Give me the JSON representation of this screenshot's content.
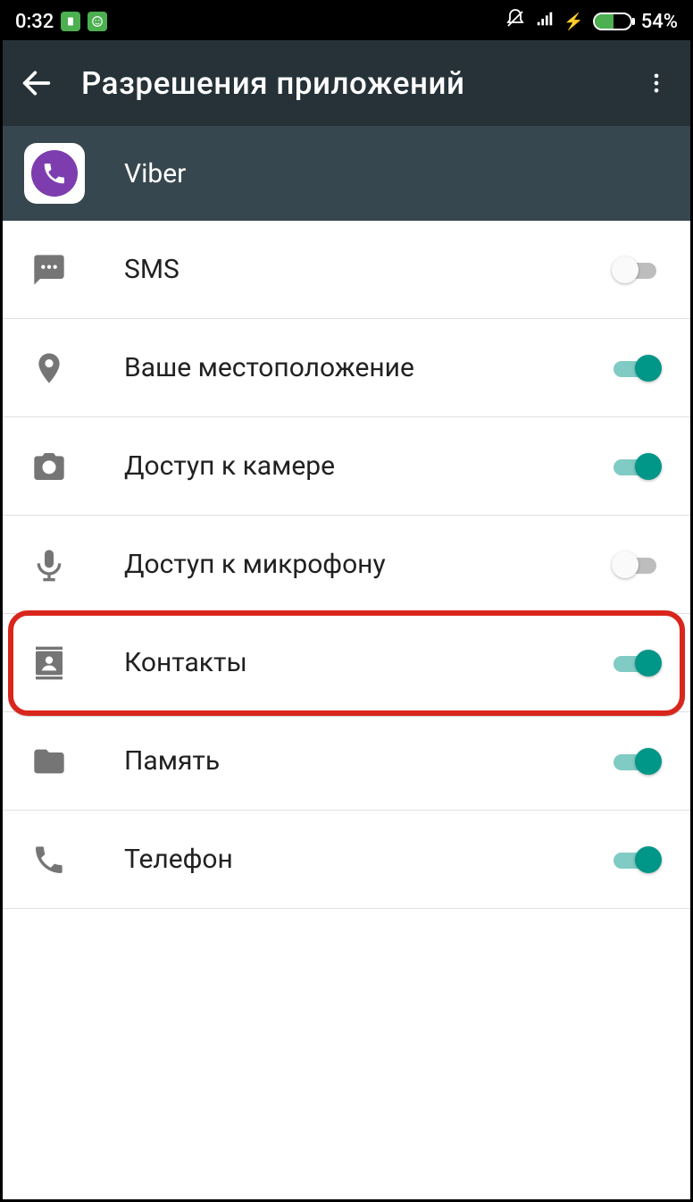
{
  "status": {
    "time": "0:32",
    "battery_pct": "54%",
    "battery_fill_color": "#4caf50",
    "battery_fill_width": "54%"
  },
  "toolbar": {
    "title": "Разрешения приложений"
  },
  "app": {
    "name": "Viber"
  },
  "permissions": [
    {
      "key": "sms",
      "label": "SMS",
      "enabled": false
    },
    {
      "key": "location",
      "label": "Ваше местоположение",
      "enabled": true
    },
    {
      "key": "camera",
      "label": "Доступ к камере",
      "enabled": true
    },
    {
      "key": "microphone",
      "label": "Доступ к микрофону",
      "enabled": false
    },
    {
      "key": "contacts",
      "label": "Контакты",
      "enabled": true,
      "highlighted": true
    },
    {
      "key": "storage",
      "label": "Память",
      "enabled": true
    },
    {
      "key": "phone",
      "label": "Телефон",
      "enabled": true
    }
  ],
  "colors": {
    "accent": "#009688",
    "track_on": "#80cbc4",
    "icon": "#757575",
    "highlight": "#d9261c"
  }
}
